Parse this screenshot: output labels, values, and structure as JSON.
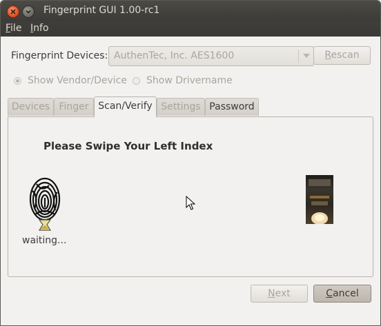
{
  "window": {
    "title": "Fingerprint GUI 1.00-rc1"
  },
  "menu": {
    "file": {
      "mnemonic": "F",
      "rest": "ile"
    },
    "info": {
      "mnemonic": "I",
      "rest": "nfo"
    }
  },
  "devices": {
    "label": "Fingerprint Devices:",
    "selected": "AuthenTec, Inc. AES1600",
    "rescan": {
      "mnemonic": "R",
      "rest": "escan"
    }
  },
  "options": {
    "show_vendor": "Show Vendor/Device",
    "show_driver": "Show Drivername",
    "selected": "show_vendor"
  },
  "tabs": [
    {
      "label": "Devices",
      "state": "disabled"
    },
    {
      "label": "Finger",
      "state": "disabled"
    },
    {
      "label": "Scan/Verify",
      "state": "active"
    },
    {
      "label": "Settings",
      "state": "disabled"
    },
    {
      "label": "Password",
      "state": "enabled"
    }
  ],
  "scan": {
    "prompt": "Please Swipe Your Left Index",
    "status": "waiting..."
  },
  "footer": {
    "next": {
      "mnemonic": "N",
      "rest": "ext"
    },
    "cancel": {
      "mnemonic": "C",
      "rest": "ancel"
    }
  },
  "icons": {
    "close": "close-icon",
    "minimize": "minimize-icon",
    "fingerprint": "fingerprint-icon",
    "dropdown": "chevron-down-icon"
  }
}
